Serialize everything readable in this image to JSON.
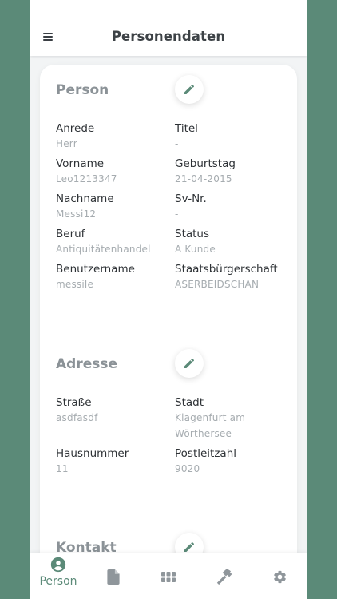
{
  "header": {
    "title": "Personendaten",
    "menu_icon": "hamburger-menu-icon"
  },
  "sections": {
    "person": {
      "title": "Person",
      "fields": [
        {
          "label": "Anrede",
          "value": "Herr"
        },
        {
          "label": "Titel",
          "value": "-"
        },
        {
          "label": "Vorname",
          "value": "Leo1213347"
        },
        {
          "label": "Geburtstag",
          "value": "21-04-2015"
        },
        {
          "label": "Nachname",
          "value": "Messi12"
        },
        {
          "label": "Sv-Nr.",
          "value": "-"
        },
        {
          "label": "Beruf",
          "value": "Antiquitätenhandel"
        },
        {
          "label": "Status",
          "value": "A Kunde"
        },
        {
          "label": "Benutzername",
          "value": "messile"
        },
        {
          "label": "Staatsbürgerschaft",
          "value": "ASERBEIDSCHAN"
        }
      ]
    },
    "adresse": {
      "title": "Adresse",
      "fields": [
        {
          "label": "Straße",
          "value": "asdfasdf"
        },
        {
          "label": "Stadt",
          "value": "Klagenfurt am Wörthersee"
        },
        {
          "label": "Hausnummer",
          "value": "11"
        },
        {
          "label": "Postleitzahl",
          "value": "9020"
        }
      ]
    },
    "kontakt": {
      "title": "Kontakt"
    }
  },
  "bottom_nav": {
    "items": [
      {
        "label": "Person",
        "icon": "person-icon",
        "active": true
      },
      {
        "icon": "document-icon"
      },
      {
        "icon": "grid-icon"
      },
      {
        "icon": "hammer-icon"
      },
      {
        "icon": "gear-icon"
      }
    ]
  },
  "colors": {
    "accent": "#5b8a78",
    "inactive_icon": "#8f969b",
    "section_title": "#8b9297",
    "label": "#2e3236",
    "value": "#a6acb0"
  }
}
